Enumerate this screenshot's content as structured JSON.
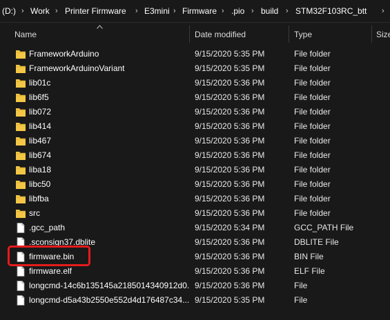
{
  "breadcrumb": {
    "items": [
      "(D:)",
      "Work",
      "Printer Firmware",
      "E3mini",
      "Firmware",
      ".pio",
      "build",
      "STM32F103RC_btt"
    ],
    "separator": "›"
  },
  "columns": {
    "name": "Name",
    "date_modified": "Date modified",
    "type": "Type",
    "size": "Size"
  },
  "files": [
    {
      "name": "FrameworkArduino",
      "date": "9/15/2020 5:35 PM",
      "type": "File folder",
      "kind": "folder"
    },
    {
      "name": "FrameworkArduinoVariant",
      "date": "9/15/2020 5:35 PM",
      "type": "File folder",
      "kind": "folder"
    },
    {
      "name": "lib01c",
      "date": "9/15/2020 5:36 PM",
      "type": "File folder",
      "kind": "folder"
    },
    {
      "name": "lib6f5",
      "date": "9/15/2020 5:36 PM",
      "type": "File folder",
      "kind": "folder"
    },
    {
      "name": "lib072",
      "date": "9/15/2020 5:36 PM",
      "type": "File folder",
      "kind": "folder"
    },
    {
      "name": "lib414",
      "date": "9/15/2020 5:36 PM",
      "type": "File folder",
      "kind": "folder"
    },
    {
      "name": "lib467",
      "date": "9/15/2020 5:36 PM",
      "type": "File folder",
      "kind": "folder"
    },
    {
      "name": "lib674",
      "date": "9/15/2020 5:36 PM",
      "type": "File folder",
      "kind": "folder"
    },
    {
      "name": "liba18",
      "date": "9/15/2020 5:36 PM",
      "type": "File folder",
      "kind": "folder"
    },
    {
      "name": "libc50",
      "date": "9/15/2020 5:36 PM",
      "type": "File folder",
      "kind": "folder"
    },
    {
      "name": "libfba",
      "date": "9/15/2020 5:36 PM",
      "type": "File folder",
      "kind": "folder"
    },
    {
      "name": "src",
      "date": "9/15/2020 5:36 PM",
      "type": "File folder",
      "kind": "folder"
    },
    {
      "name": ".gcc_path",
      "date": "9/15/2020 5:34 PM",
      "type": "GCC_PATH File",
      "kind": "file"
    },
    {
      "name": ".sconsign37.dblite",
      "date": "9/15/2020 5:36 PM",
      "type": "DBLITE File",
      "kind": "file"
    },
    {
      "name": "firmware.bin",
      "date": "9/15/2020 5:36 PM",
      "type": "BIN File",
      "kind": "file"
    },
    {
      "name": "firmware.elf",
      "date": "9/15/2020 5:36 PM",
      "type": "ELF File",
      "kind": "file"
    },
    {
      "name": "longcmd-14c6b135145a2185014340912d0...",
      "date": "9/15/2020 5:36 PM",
      "type": "File",
      "kind": "file"
    },
    {
      "name": "longcmd-d5a43b2550e552d4d176487c34...",
      "date": "9/15/2020 5:35 PM",
      "type": "File",
      "kind": "file"
    }
  ],
  "highlighted_file": "firmware.bin",
  "colors": {
    "background": "#191919",
    "folder": "#f3c745",
    "highlight": "#e51b1b"
  },
  "icons": {
    "folder": "folder-icon",
    "file": "file-icon",
    "chevron": "chevron-down-icon",
    "sort": "sort-ascending-icon"
  }
}
